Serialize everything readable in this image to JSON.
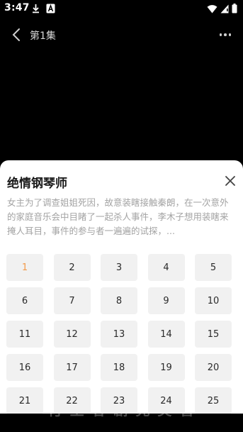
{
  "status_bar": {
    "time": "3:47"
  },
  "header": {
    "episode_title": "第1集"
  },
  "behind_sheet_text": "付 土 谷 剧 完 美 管",
  "sheet": {
    "title": "绝情钢琴师",
    "description": "女主为了调查姐姐死因，故意装瞎接触秦朗，在一次意外的家庭音乐会中目睹了一起杀人事件，李木子想用装瞎来掩人耳目，事件的参与者一遍遍的试探，...",
    "active_episode": "1",
    "episodes": [
      "1",
      "2",
      "3",
      "4",
      "5",
      "6",
      "7",
      "8",
      "9",
      "10",
      "11",
      "12",
      "13",
      "14",
      "15",
      "16",
      "17",
      "18",
      "19",
      "20",
      "21",
      "22",
      "23",
      "24",
      "25"
    ]
  },
  "colors": {
    "accent": "#f29a4a",
    "tile_bg": "#f1f1f1",
    "desc": "#a3a3a3"
  },
  "icons": [
    "download-icon",
    "a-badge-icon",
    "wifi-icon",
    "signal-icon",
    "battery-icon",
    "back-chevron-icon",
    "more-dots-icon",
    "close-icon"
  ]
}
